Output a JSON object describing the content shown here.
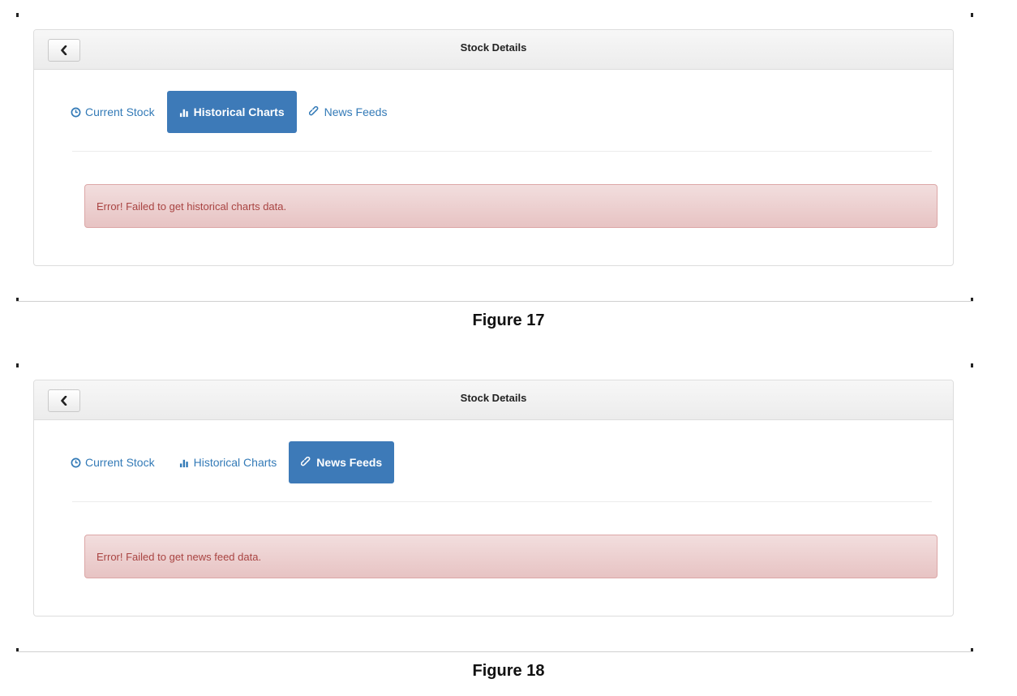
{
  "figures": [
    {
      "header_title": "Stock Details",
      "back_icon": "chevron-left-icon",
      "tabs": [
        {
          "label": "Current Stock",
          "icon": "clock-icon",
          "active": false
        },
        {
          "label": "Historical Charts",
          "icon": "bar-chart-icon",
          "active": true
        },
        {
          "label": "News Feeds",
          "icon": "link-icon",
          "active": false
        }
      ],
      "alert_text": "Error! Failed to get historical charts data.",
      "caption": "Figure 17"
    },
    {
      "header_title": "Stock Details",
      "back_icon": "chevron-left-icon",
      "tabs": [
        {
          "label": "Current Stock",
          "icon": "clock-icon",
          "active": false
        },
        {
          "label": "Historical Charts",
          "icon": "bar-chart-icon",
          "active": false
        },
        {
          "label": "News Feeds",
          "icon": "link-icon",
          "active": true
        }
      ],
      "alert_text": "Error! Failed to get news feed data.",
      "caption": "Figure 18"
    }
  ],
  "colors": {
    "tab_link": "#337ab7",
    "tab_active_bg": "#3d7ab8",
    "alert_bg": "#f2dede",
    "alert_border": "#dca7a7",
    "alert_text": "#a94442"
  }
}
